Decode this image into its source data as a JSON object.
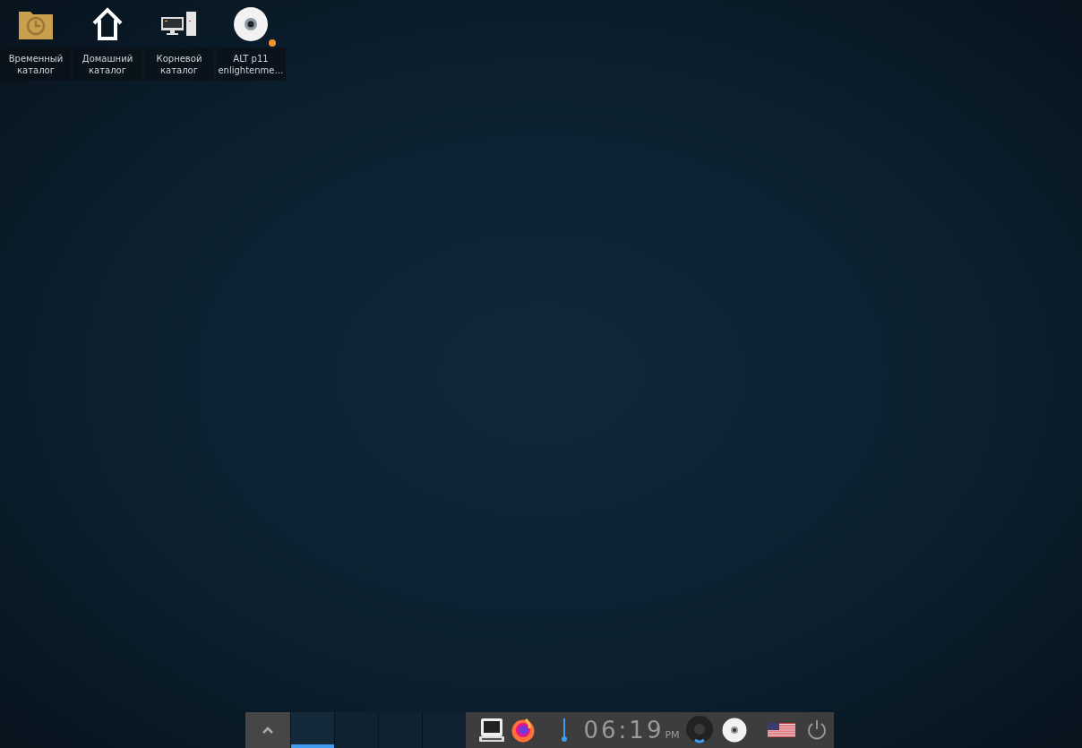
{
  "desktop_icons": [
    {
      "kind": "folder",
      "label": [
        "Временный",
        "каталог"
      ],
      "badge": false
    },
    {
      "kind": "home",
      "label": [
        "Домашний",
        "каталог"
      ],
      "badge": false
    },
    {
      "kind": "computer",
      "label": [
        "Корневой",
        "каталог"
      ],
      "badge": false
    },
    {
      "kind": "disc",
      "label": [
        "ALT p11",
        "enlightenme…"
      ],
      "badge": true
    }
  ],
  "taskbar": {
    "desks": [
      {
        "selected": true
      },
      {
        "selected": false
      },
      {
        "selected": false
      },
      {
        "selected": false
      }
    ],
    "clock": {
      "time": "06:19",
      "ampm": "PM"
    }
  }
}
